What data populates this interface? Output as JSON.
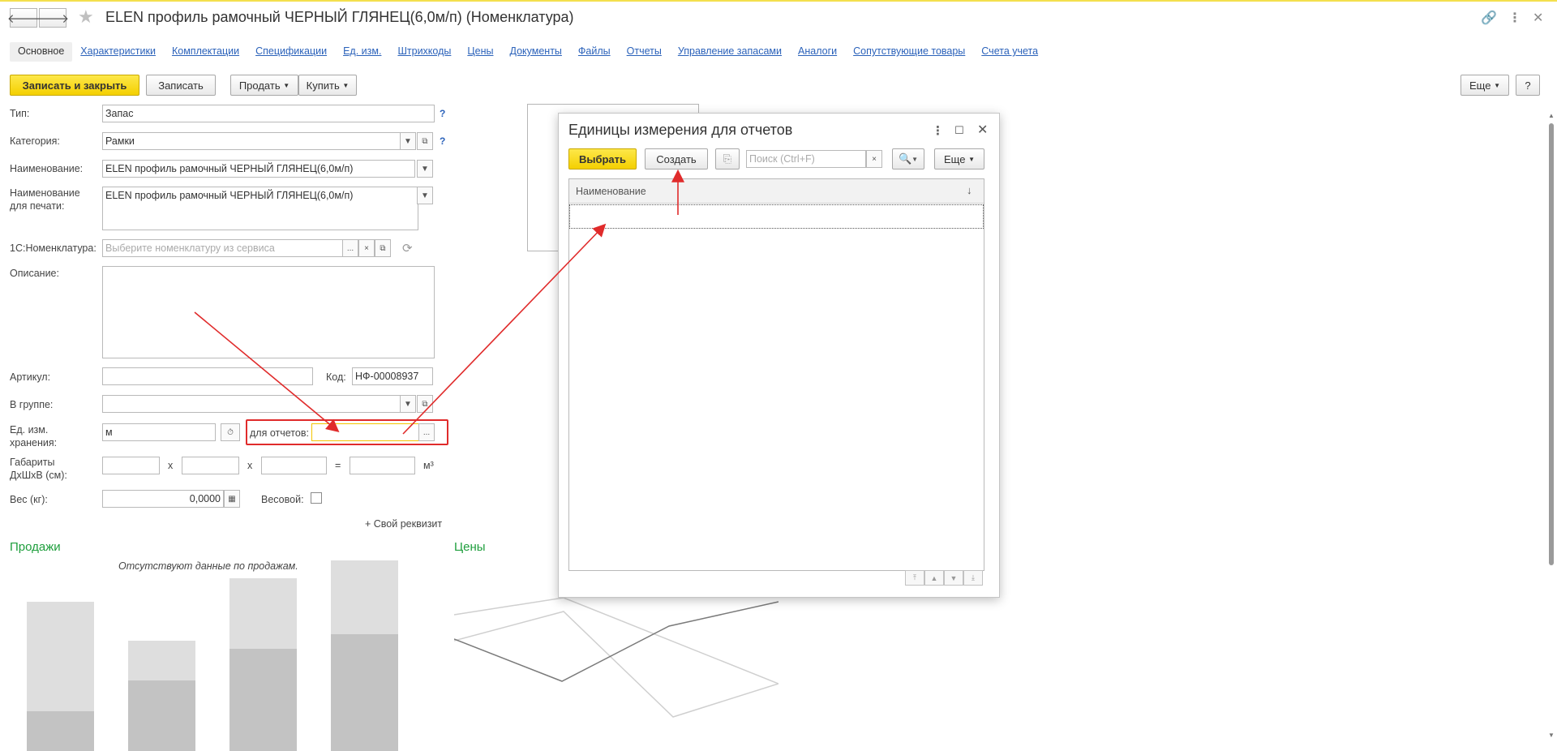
{
  "header": {
    "title": "ELEN профиль рамочный  ЧЕРНЫЙ ГЛЯНЕЦ(6,0м/п) (Номенклатура)",
    "back_icon": "arrow-left-icon",
    "forward_icon": "arrow-right-icon",
    "favorite_icon": "star-icon"
  },
  "tabs": [
    {
      "label": "Основное"
    },
    {
      "label": "Характеристики"
    },
    {
      "label": "Комплектации"
    },
    {
      "label": "Спецификации"
    },
    {
      "label": "Ед. изм."
    },
    {
      "label": "Штрихкоды"
    },
    {
      "label": "Цены"
    },
    {
      "label": "Документы"
    },
    {
      "label": "Файлы"
    },
    {
      "label": "Отчеты"
    },
    {
      "label": "Управление запасами"
    },
    {
      "label": "Аналоги"
    },
    {
      "label": "Сопутствующие товары"
    },
    {
      "label": "Счета учета"
    }
  ],
  "toolbar": {
    "save_close": "Записать и закрыть",
    "save": "Записать",
    "sell": "Продать",
    "buy": "Купить",
    "more": "Еще",
    "help": "?"
  },
  "form": {
    "type_label": "Тип:",
    "type_value": "Запас",
    "category_label": "Категория:",
    "category_value": "Рамки",
    "name_label": "Наименование:",
    "name_value": "ELEN профиль рамочный  ЧЕРНЫЙ ГЛЯНЕЦ(6,0м/п)",
    "print_name_label_1": "Наименование",
    "print_name_label_2": "для печати:",
    "print_name_value": "ELEN профиль рамочный  ЧЕРНЫЙ ГЛЯНЕЦ(6,0м/п)",
    "nom1c_label": "1С:Номенклатура:",
    "nom1c_placeholder": "Выберите номенклатуру из сервиса",
    "description_label": "Описание:",
    "article_label": "Артикул:",
    "code_label": "Код:",
    "code_value": "НФ-00008937",
    "group_label": "В группе:",
    "unit_label_1": "Ед. изм.",
    "unit_label_2": "хранения:",
    "unit_value": "м",
    "reports_label": "для отчетов:",
    "dims_label_1": "Габариты",
    "dims_label_2": "ДхШхВ (см):",
    "dims_x": "x",
    "dims_eq": "=",
    "dims_unit": "м³",
    "weight_label": "Вес (кг):",
    "weight_value": "0,0000",
    "weighted_label": "Весовой:",
    "custom_attr": "+ Свой реквизит",
    "qmark": "?",
    "ellipsis": "...",
    "clear": "×"
  },
  "sales": {
    "title": "Продажи",
    "empty": "Отсутствуют данные по продажам."
  },
  "prices": {
    "title": "Цены"
  },
  "dialog": {
    "title": "Единицы измерения для отчетов",
    "select": "Выбрать",
    "create": "Создать",
    "search_placeholder": "Поиск (Ctrl+F)",
    "more": "Еще",
    "column": "Наименование",
    "sort_icon": "↓"
  },
  "colors": {
    "accent_yellow": "#f4d000",
    "link_blue": "#2b62ba",
    "section_green": "#1e9e3c",
    "annotation_red": "#e02b2b"
  }
}
